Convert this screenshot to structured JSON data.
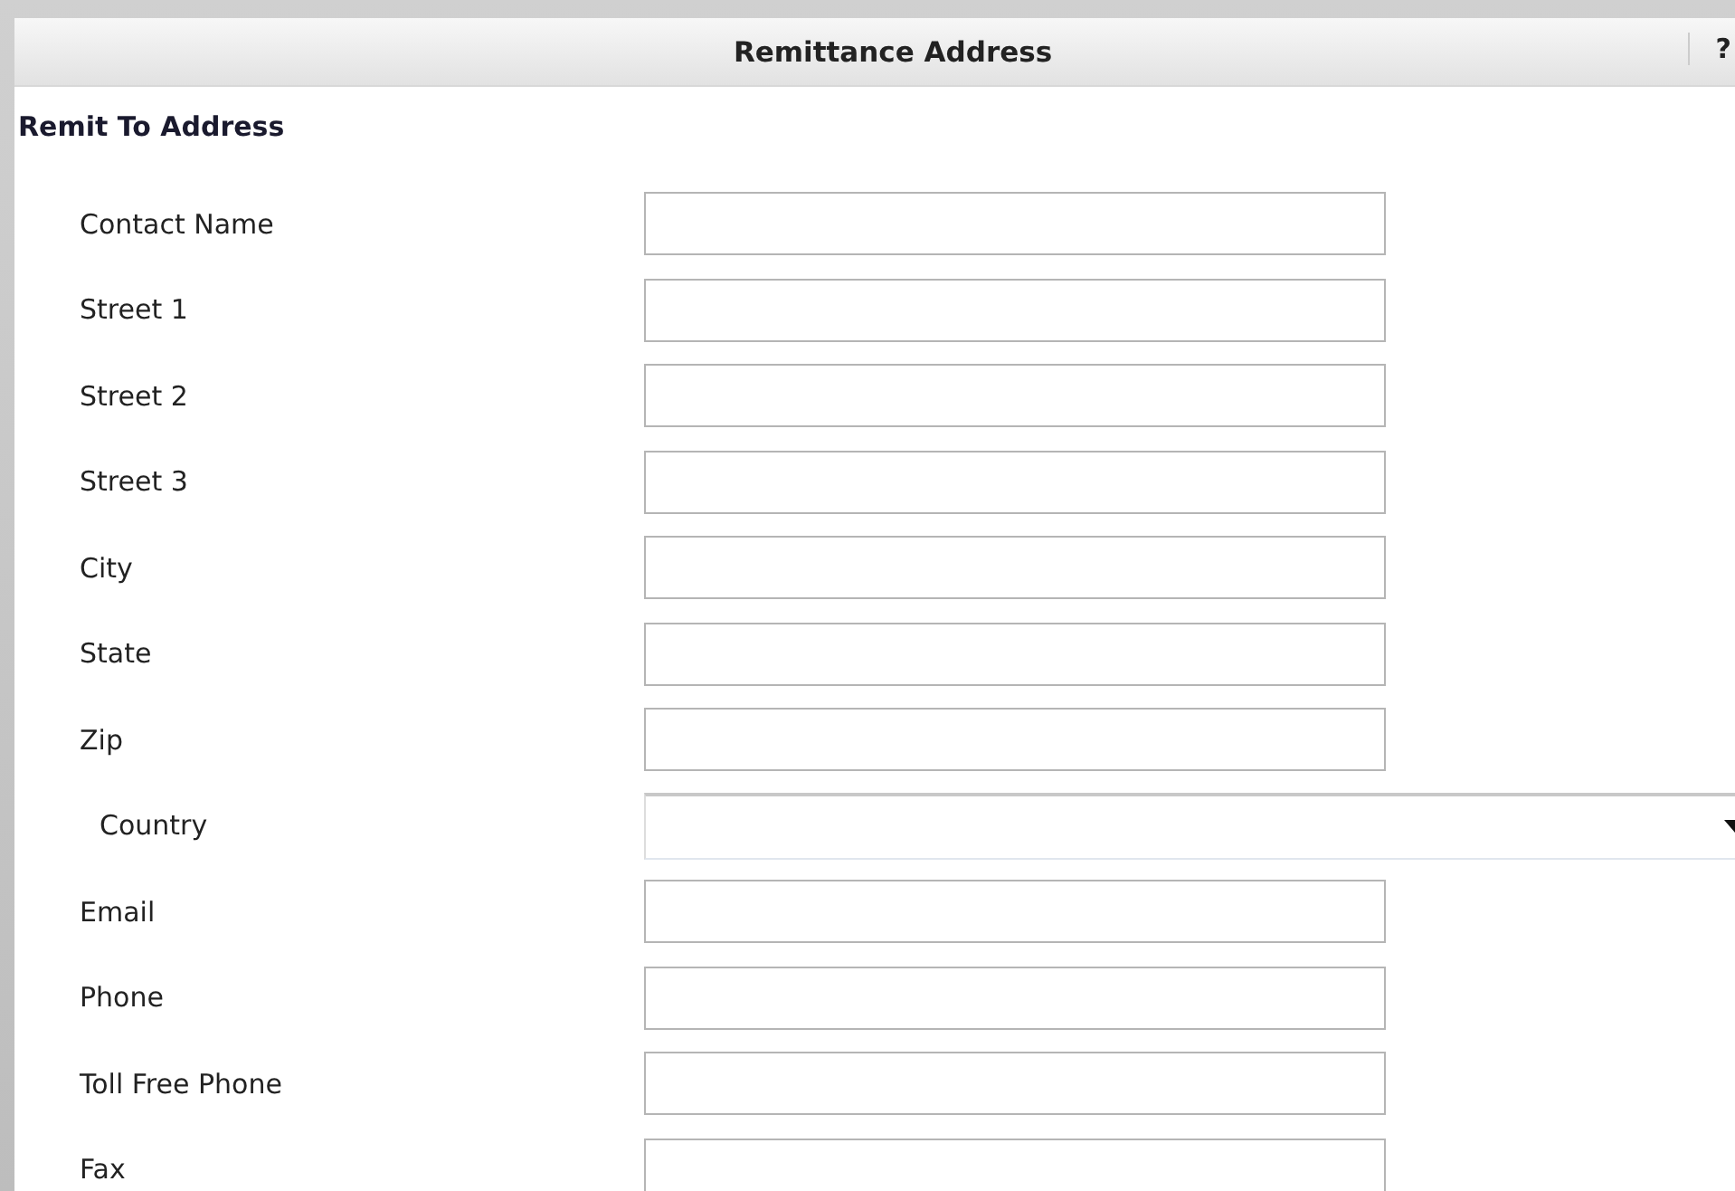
{
  "window": {
    "title": "Remittance Address",
    "help": "?"
  },
  "section": {
    "title": "Remit To Address"
  },
  "fields": [
    {
      "label": "Contact Name",
      "kind": "text"
    },
    {
      "label": "Street 1",
      "kind": "text"
    },
    {
      "label": "Street 2",
      "kind": "text"
    },
    {
      "label": "Street 3",
      "kind": "text"
    },
    {
      "label": "City",
      "kind": "text"
    },
    {
      "label": "State",
      "kind": "text"
    },
    {
      "label": "Zip",
      "kind": "text"
    },
    {
      "label": "Country",
      "kind": "select"
    },
    {
      "label": "Email",
      "kind": "text"
    },
    {
      "label": "Phone",
      "kind": "text"
    },
    {
      "label": "Toll Free Phone",
      "kind": "text"
    },
    {
      "label": "Fax",
      "kind": "text"
    }
  ]
}
